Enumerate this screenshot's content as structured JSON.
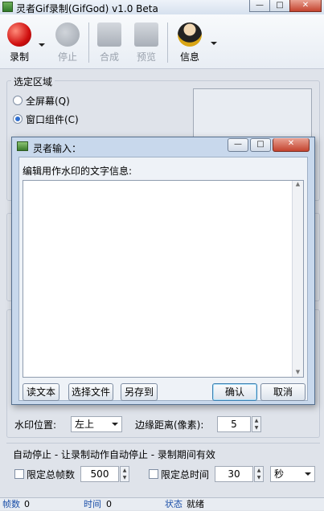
{
  "window": {
    "title": "灵者Gif录制(GifGod) v1.0 Beta",
    "min": "—",
    "max": "□",
    "close": "✕"
  },
  "toolbar": {
    "record": "录制",
    "stop": "停止",
    "compose": "合成",
    "preview": "预览",
    "info": "信息"
  },
  "region": {
    "title": "选定区域",
    "fullscreen": "全屏幕(Q)",
    "window_component": "窗口组件(C)"
  },
  "dialog": {
    "title": "灵者输入：",
    "prompt": "编辑用作水印的文字信息:",
    "text_value": "",
    "buttons": {
      "read_text": "读文本",
      "choose_file": "选择文件",
      "save_as": "另存到",
      "ok": "确认",
      "cancel": "取消"
    }
  },
  "watermark": {
    "position_label": "水印位置:",
    "position_value": "左上",
    "margin_label": "边缘距离(像素):",
    "margin_value": "5"
  },
  "autostop": {
    "label": "自动停止 - 让录制动作自动停止 - 录制期间有效",
    "frames_label": "限定总帧数",
    "frames_value": "500",
    "time_label": "限定总时间",
    "time_value": "30",
    "time_unit": "秒"
  },
  "statusbar": {
    "frames_label": "帧数",
    "frames_value": "0",
    "time_label": "时间",
    "time_value": "0",
    "state_label": "状态",
    "state_value": "就绪"
  },
  "colors": {
    "accent": "#2f6fd0",
    "status_label": "#1b4fa8",
    "record_red": "#d01010"
  }
}
